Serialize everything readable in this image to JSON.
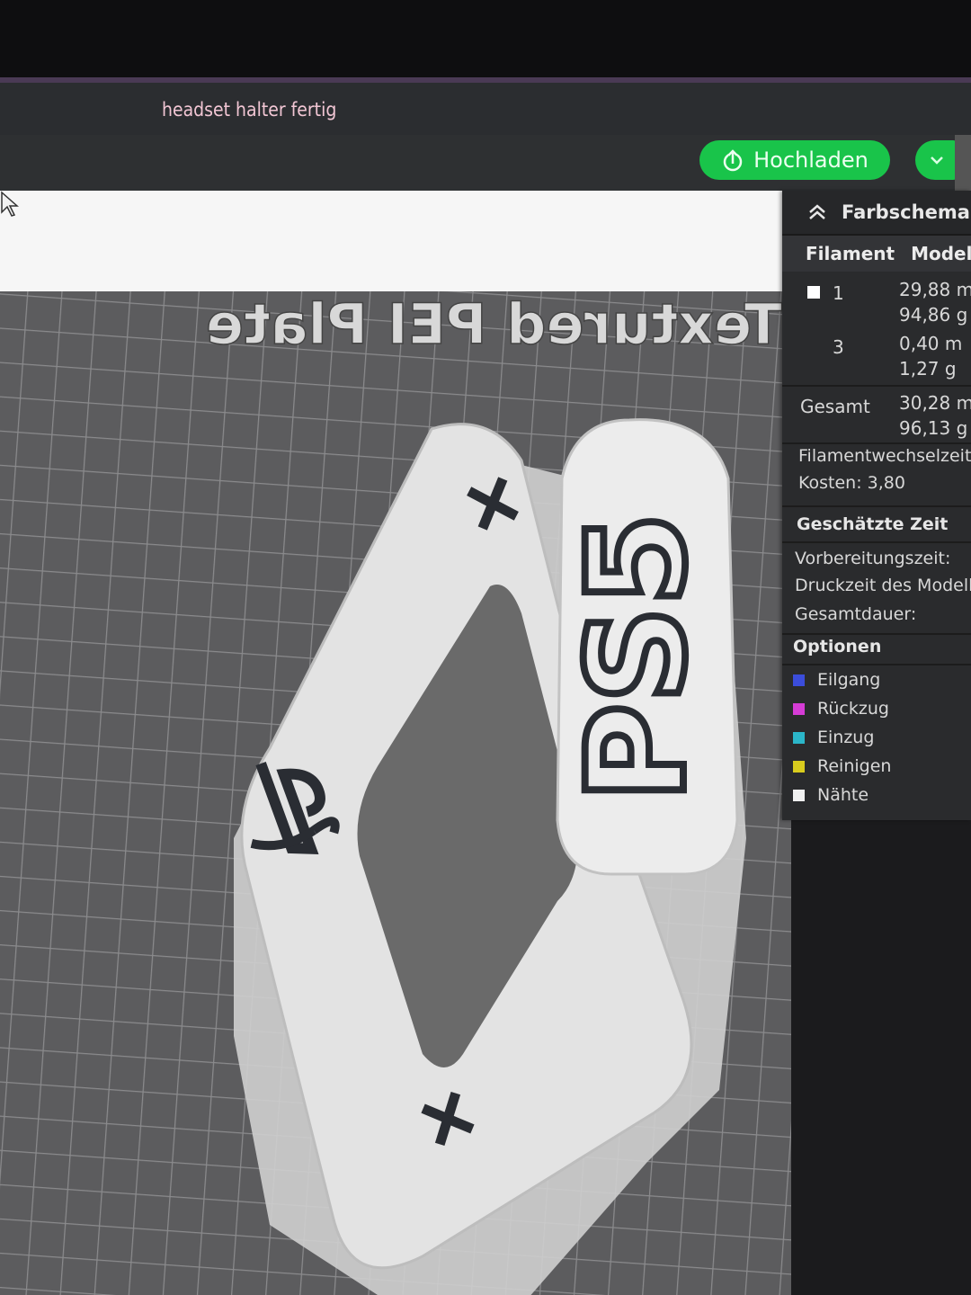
{
  "window": {
    "title": "headset halter fertig"
  },
  "toolbar": {
    "upload_label": "Hochladen"
  },
  "viewport": {
    "plate_label": "Textured PEI Plate",
    "model_text": "PS5"
  },
  "panel": {
    "header": "Farbschema",
    "columns": {
      "filament": "Filament",
      "model": "Modell"
    },
    "filaments": [
      {
        "id": "1",
        "length": "29,88 m",
        "weight": "94,86 g",
        "color": "#ffffff"
      },
      {
        "id": "3",
        "length": "0,40 m",
        "weight": "1,27 g",
        "color": "#2a2b2d"
      }
    ],
    "total": {
      "label": "Gesamt",
      "length": "30,28 m",
      "weight": "96,13 g"
    },
    "change_time_label": "Filamentwechselzeit",
    "cost": "Kosten: 3,80",
    "estimated_time": {
      "title": "Geschätzte Zeit",
      "prep": "Vorbereitungszeit:",
      "model_print": "Druckzeit des Modell",
      "total": "Gesamtdauer:"
    },
    "options": {
      "title": "Optionen",
      "items": [
        {
          "label": "Eilgang",
          "color": "#3b4ddb"
        },
        {
          "label": "Rückzug",
          "color": "#d63cd6"
        },
        {
          "label": "Einzug",
          "color": "#2bb6c9"
        },
        {
          "label": "Reinigen",
          "color": "#d9cc1e"
        },
        {
          "label": "Nähte",
          "color": "#f0f0f0"
        }
      ]
    }
  }
}
